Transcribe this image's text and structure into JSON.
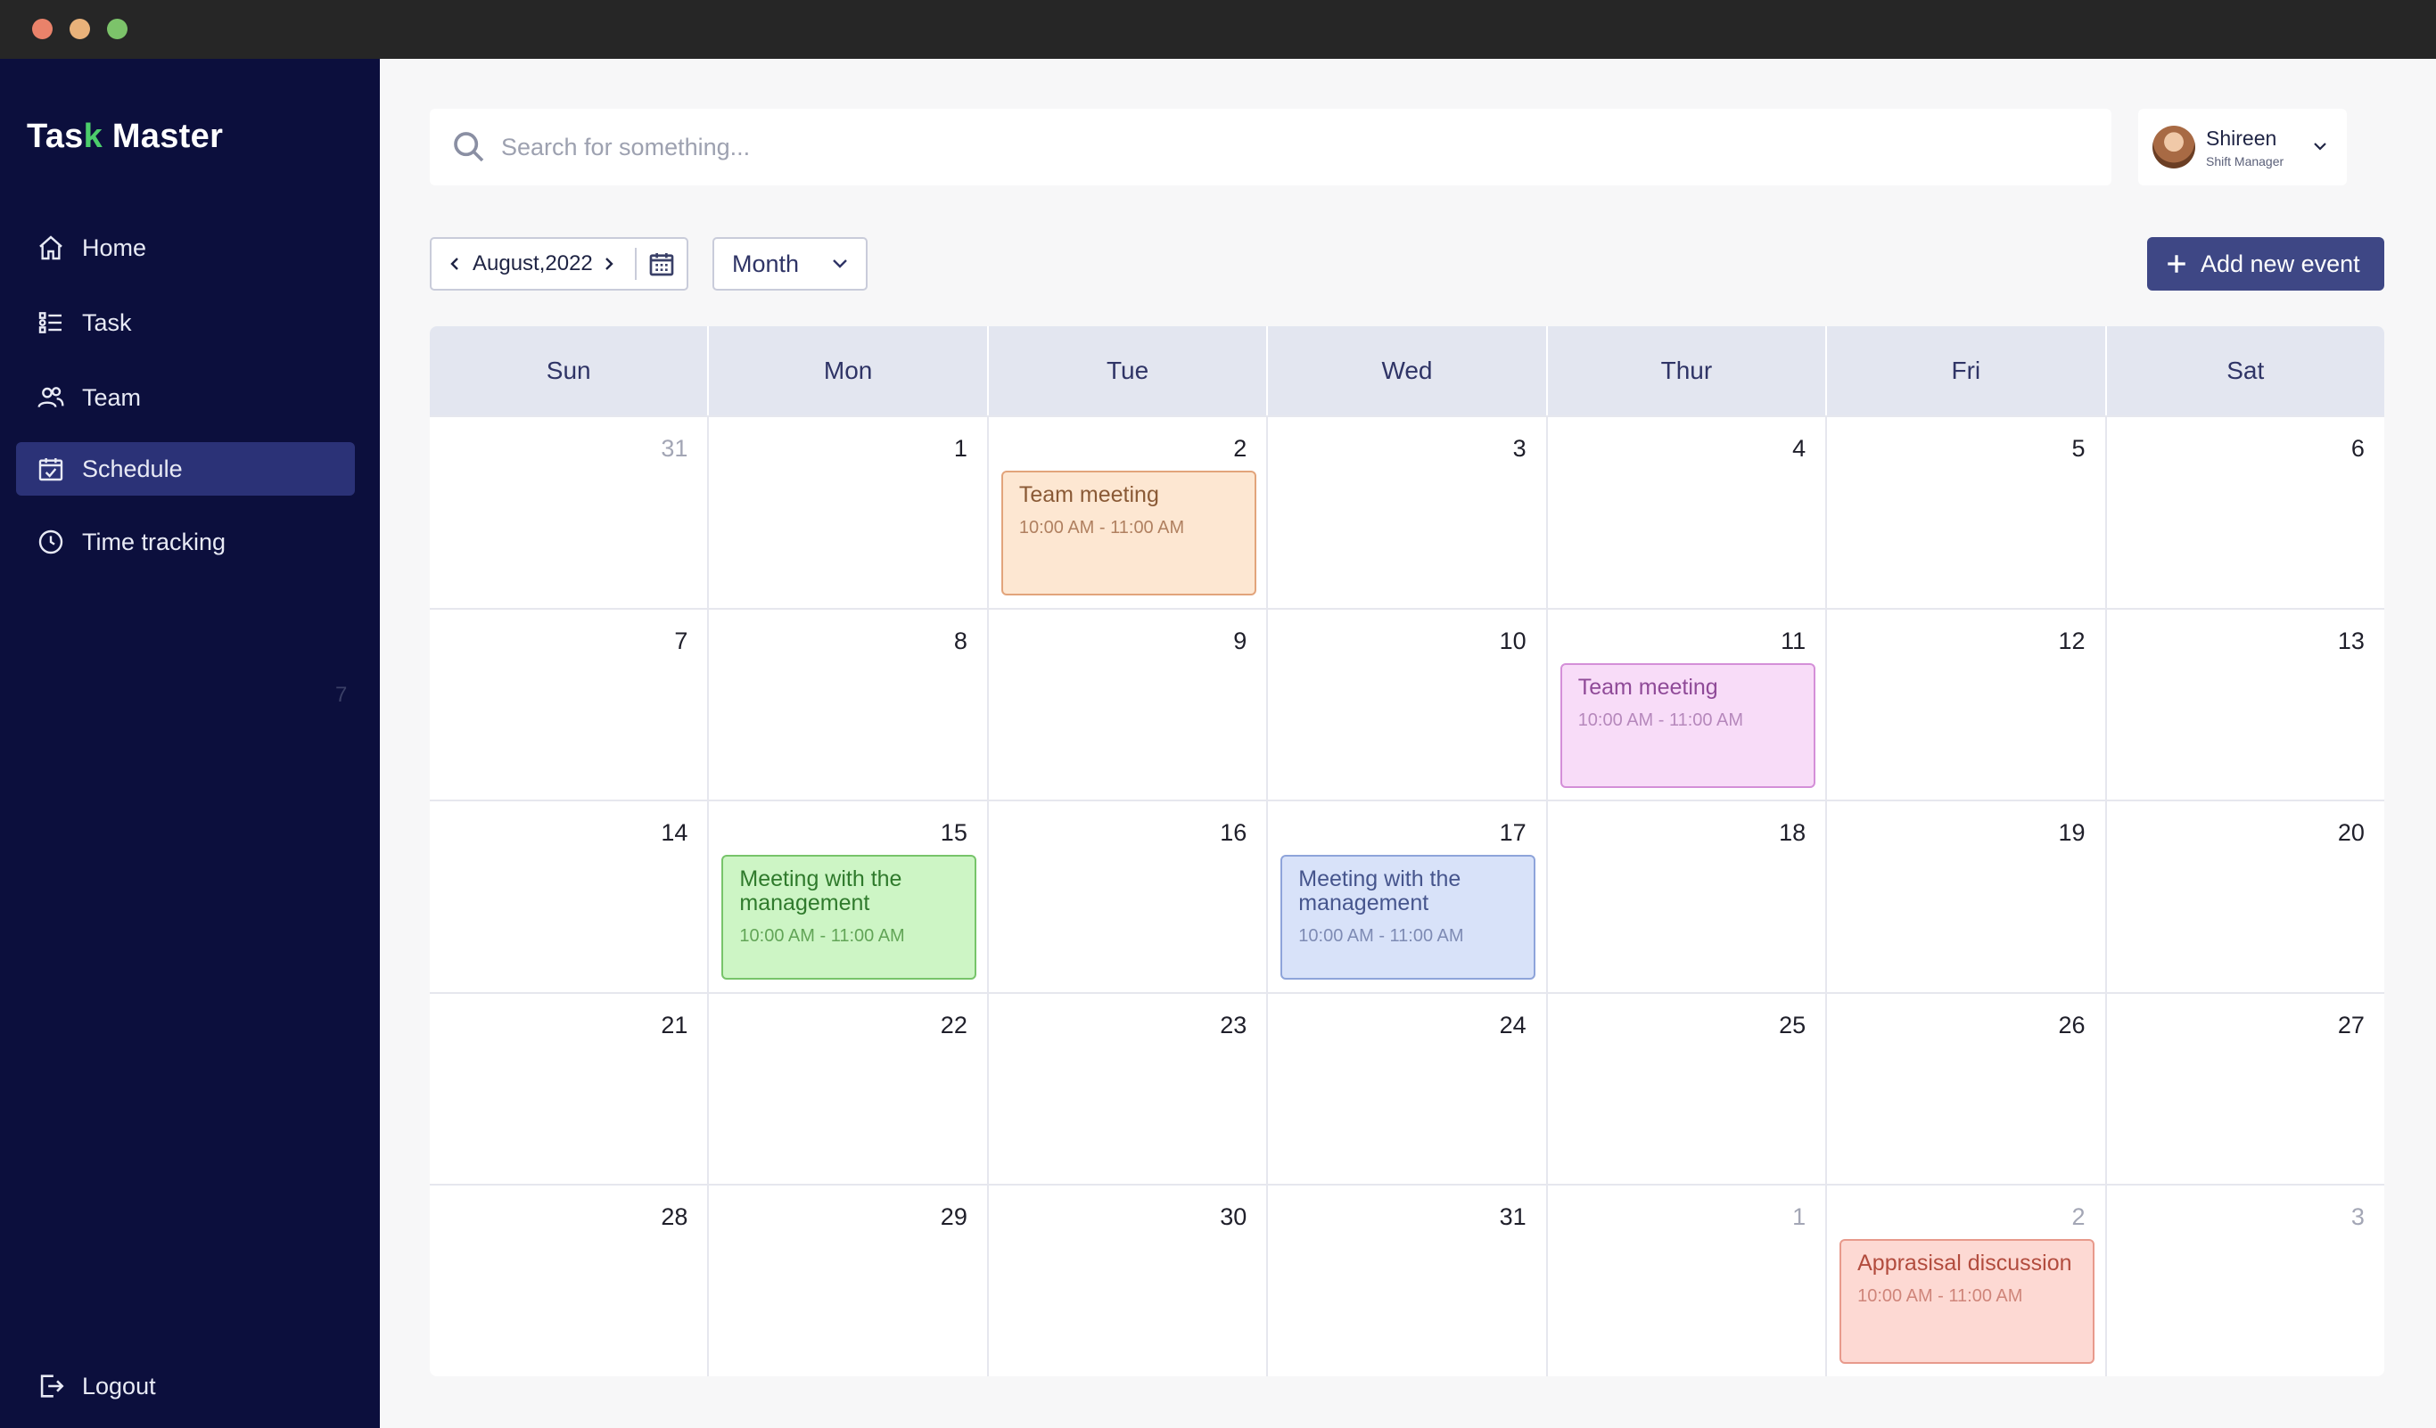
{
  "window": {
    "controls": [
      "close",
      "minimize",
      "maximize"
    ]
  },
  "sidebar": {
    "logo_pre": "Tas",
    "logo_check": "k",
    "logo_post": " Master",
    "items": [
      {
        "label": "Home",
        "icon": "home-icon",
        "active": false
      },
      {
        "label": "Task",
        "icon": "task-list-icon",
        "active": false
      },
      {
        "label": "Team",
        "icon": "team-icon",
        "active": false
      },
      {
        "label": "Schedule",
        "icon": "calendar-check-icon",
        "active": true
      },
      {
        "label": "Time tracking",
        "icon": "clock-icon",
        "active": false
      }
    ],
    "stray_number": "7",
    "logout_label": "Logout"
  },
  "header": {
    "search_placeholder": "Search for something...",
    "user_name": "Shireen",
    "user_role": "Shift Manager"
  },
  "toolbar": {
    "month_label": "August,2022",
    "view_label": "Month",
    "add_event_label": "Add new event"
  },
  "calendar": {
    "weekdays": [
      "Sun",
      "Mon",
      "Tue",
      "Wed",
      "Thur",
      "Fri",
      "Sat"
    ],
    "weeks": [
      [
        {
          "day": "31",
          "muted": true
        },
        {
          "day": "1"
        },
        {
          "day": "2",
          "event": {
            "title": "Team meeting",
            "time": "10:00 AM - 11:00 AM",
            "color": "orange"
          }
        },
        {
          "day": "3"
        },
        {
          "day": "4"
        },
        {
          "day": "5"
        },
        {
          "day": "6"
        }
      ],
      [
        {
          "day": "7"
        },
        {
          "day": "8"
        },
        {
          "day": "9"
        },
        {
          "day": "10"
        },
        {
          "day": "11",
          "event": {
            "title": "Team meeting",
            "time": "10:00 AM - 11:00 AM",
            "color": "pink"
          }
        },
        {
          "day": "12"
        },
        {
          "day": "13"
        }
      ],
      [
        {
          "day": "14"
        },
        {
          "day": "15",
          "event": {
            "title": "Meeting with the management",
            "time": "10:00 AM - 11:00 AM",
            "color": "green"
          }
        },
        {
          "day": "16"
        },
        {
          "day": "17",
          "event": {
            "title": "Meeting with the management",
            "time": "10:00 AM - 11:00 AM",
            "color": "blue"
          }
        },
        {
          "day": "18"
        },
        {
          "day": "19"
        },
        {
          "day": "20"
        }
      ],
      [
        {
          "day": "21"
        },
        {
          "day": "22"
        },
        {
          "day": "23"
        },
        {
          "day": "24"
        },
        {
          "day": "25"
        },
        {
          "day": "26"
        },
        {
          "day": "27"
        }
      ],
      [
        {
          "day": "28"
        },
        {
          "day": "29"
        },
        {
          "day": "30"
        },
        {
          "day": "31"
        },
        {
          "day": "1",
          "muted": true
        },
        {
          "day": "2",
          "muted": true,
          "event": {
            "title": "Apprasisal discussion",
            "time": "10:00 AM - 11:00 AM",
            "color": "red"
          }
        },
        {
          "day": "3",
          "muted": true
        }
      ]
    ]
  },
  "colors": {
    "sidebar_bg": "#0c0f3d",
    "active_nav": "#2b3277",
    "primary_button": "#3e4785",
    "header_row": "#e3e6f0",
    "logo_check": "#4ccd6b"
  }
}
